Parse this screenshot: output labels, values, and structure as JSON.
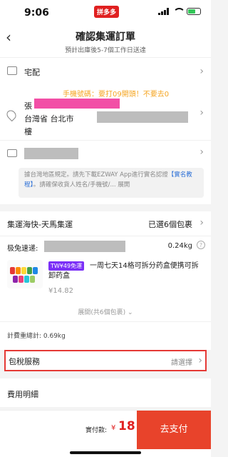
{
  "status_bar": {
    "time": "9:06",
    "brand": "拼多多"
  },
  "nav": {
    "back_icon": "‹",
    "title": "確認集運訂單",
    "subtitle": "預計出庫後5-7個工作日送達"
  },
  "delivery": {
    "label": "宅配"
  },
  "address": {
    "note": "手機號碼：要打09開頭！不要去0",
    "name_prefix": "張",
    "city": "台灣省 台北市",
    "line2": "樓"
  },
  "id_notice": {
    "text_before": "據台灣地區規定。請先下載EZWAY App進行實名認證",
    "link": "【實名教程】",
    "text_after": "。請確保收貨人姓名/手機號/... 展開"
  },
  "shipping": {
    "name": "集運海快-天馬集運",
    "selected": "已選6個包裹"
  },
  "fast": {
    "label": "极兔速递:",
    "weight": "0.24kg",
    "help": "?"
  },
  "product": {
    "badge": "TW¥49免運",
    "title": "一周七天14格可拆分药盒便携可拆卸药盒",
    "price": "¥14.82"
  },
  "expand_label": "展開(共6個包裹)",
  "total_weight": "計費重總計: 0.69kg",
  "tax": {
    "label": "包稅服務",
    "select": "請選擇"
  },
  "fee_heading": "費用明細",
  "footer": {
    "pay_label": "實付款:",
    "currency": "¥",
    "amount": "18",
    "pay_button": "去支付"
  },
  "colors": {
    "accent": "#e8432b",
    "redact_pink": "#f24fa6",
    "redact_gray": "#bdbdbd",
    "badge": "#7b2ff7",
    "note": "#f5a623"
  },
  "icons": [
    "back-icon",
    "truck-icon",
    "location-pin-icon",
    "id-card-icon",
    "chevron-right-icon",
    "help-icon",
    "chevron-down-icon"
  ]
}
